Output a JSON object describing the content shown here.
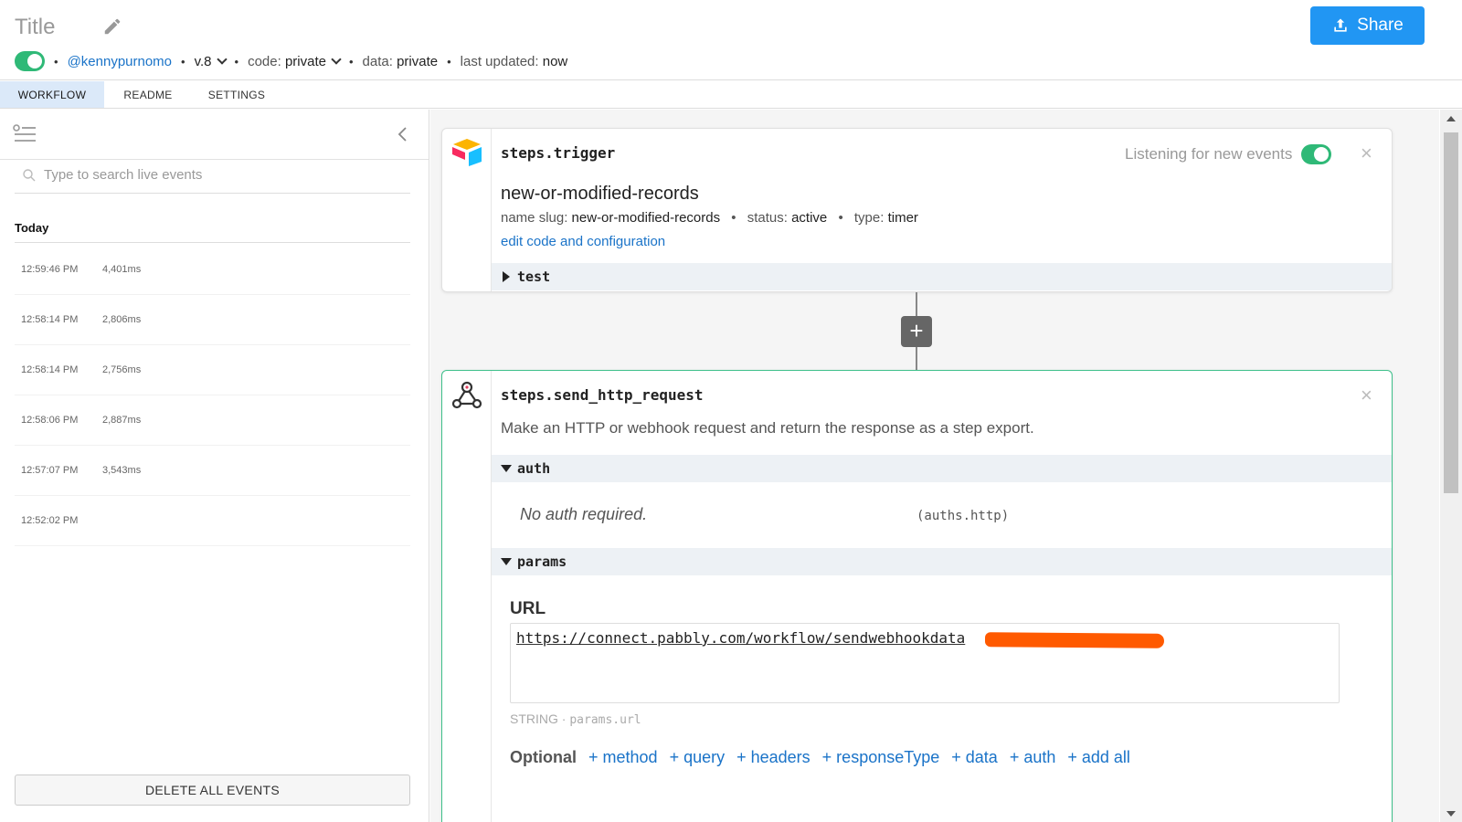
{
  "header": {
    "title": "Title",
    "share_label": "Share",
    "username": "@kennypurnomo",
    "version": "v.8",
    "code_label": "code:",
    "code_value": "private",
    "data_label": "data:",
    "data_value": "private",
    "updated_label": "last updated:",
    "updated_value": "now",
    "active": true
  },
  "tabs": [
    {
      "label": "WORKFLOW",
      "active": true
    },
    {
      "label": "README",
      "active": false
    },
    {
      "label": "SETTINGS",
      "active": false
    }
  ],
  "sidebar": {
    "search_placeholder": "Type to search live events",
    "group_label": "Today",
    "events": [
      {
        "time": "12:59:46 PM",
        "duration": "4,401ms"
      },
      {
        "time": "12:58:14 PM",
        "duration": "2,806ms"
      },
      {
        "time": "12:58:14 PM",
        "duration": "2,756ms"
      },
      {
        "time": "12:58:06 PM",
        "duration": "2,887ms"
      },
      {
        "time": "12:57:07 PM",
        "duration": "3,543ms"
      },
      {
        "time": "12:52:02 PM",
        "duration": ""
      }
    ],
    "delete_label": "DELETE ALL EVENTS"
  },
  "trigger": {
    "step_name": "steps.trigger",
    "listening_label": "Listening for new events",
    "source_name": "new-or-modified-records",
    "slug_label": "name slug:",
    "slug_value": "new-or-modified-records",
    "status_label": "status:",
    "status_value": "active",
    "type_label": "type:",
    "type_value": "timer",
    "edit_link": "edit code and configuration",
    "test_label": "test"
  },
  "http_step": {
    "step_name": "steps.send_http_request",
    "description": "Make an HTTP or webhook request and return the response as a step export.",
    "auth_section": "auth",
    "auth_note": "No auth required.",
    "auth_code": "(auths.http)",
    "params_section": "params",
    "url_label": "URL",
    "url_value": "https://connect.pabbly.com/workflow/sendwebhookdata",
    "url_type": "STRING ·",
    "url_path": "params.url",
    "optional_label": "Optional",
    "optional_items": [
      "+ method",
      "+ query",
      "+ headers",
      "+ responseType",
      "+ data",
      "+ auth",
      "+ add all"
    ]
  },
  "colors": {
    "accent": "#2196f3",
    "toggle_on": "#2fb977",
    "link": "#1a73c8",
    "active_card_border": "#3dbf8a",
    "redaction": "#ff5a00"
  }
}
